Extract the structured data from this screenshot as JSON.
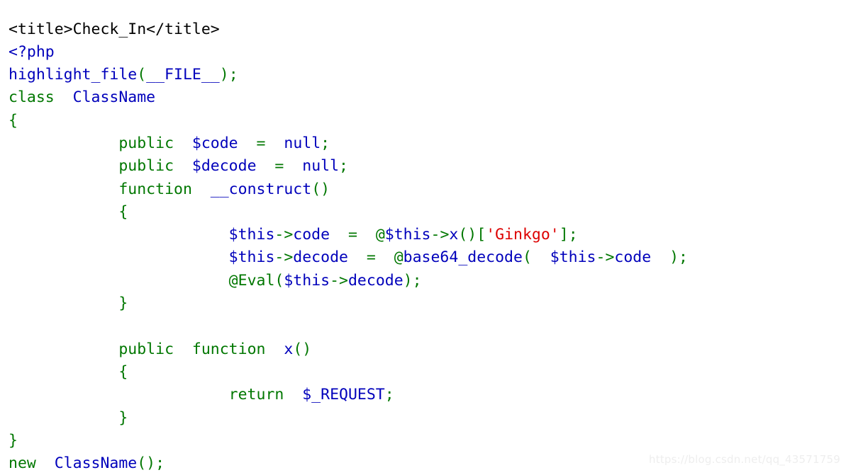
{
  "page": {
    "kind": "php-highlight_file-output",
    "background": "#ffffff",
    "colors": {
      "keyword": "#007700",
      "string": "#DD0000",
      "default": "#0000BB",
      "html": "#000000",
      "watermark": "#eeeeee"
    }
  },
  "watermark": {
    "text": "https://blog.csdn.net/qq_43571759"
  },
  "code": {
    "lines": [
      {
        "n": 1,
        "tokens": [
          {
            "t": "<title>Check_In</title>",
            "c": "html"
          }
        ]
      },
      {
        "n": 2,
        "tokens": [
          {
            "t": "<?php",
            "c": "df"
          }
        ]
      },
      {
        "n": 3,
        "tokens": [
          {
            "t": "highlight_file",
            "c": "df"
          },
          {
            "t": "(",
            "c": "kw"
          },
          {
            "t": "__FILE__",
            "c": "df"
          },
          {
            "t": ")",
            "c": "kw"
          },
          {
            "t": ";",
            "c": "kw"
          }
        ]
      },
      {
        "n": 4,
        "tokens": [
          {
            "t": "class",
            "c": "kw"
          },
          {
            "t": "  ",
            "c": "kw"
          },
          {
            "t": "ClassName",
            "c": "df"
          }
        ]
      },
      {
        "n": 5,
        "tokens": [
          {
            "t": "{",
            "c": "kw"
          }
        ]
      },
      {
        "n": 6,
        "tokens": [
          {
            "t": "            ",
            "c": "kw"
          },
          {
            "t": "public",
            "c": "kw"
          },
          {
            "t": "  ",
            "c": "kw"
          },
          {
            "t": "$code",
            "c": "df"
          },
          {
            "t": "  ",
            "c": "kw"
          },
          {
            "t": "=",
            "c": "kw"
          },
          {
            "t": "  ",
            "c": "kw"
          },
          {
            "t": "null",
            "c": "df"
          },
          {
            "t": ";",
            "c": "kw"
          }
        ]
      },
      {
        "n": 7,
        "tokens": [
          {
            "t": "            ",
            "c": "kw"
          },
          {
            "t": "public",
            "c": "kw"
          },
          {
            "t": "  ",
            "c": "kw"
          },
          {
            "t": "$decode",
            "c": "df"
          },
          {
            "t": "  ",
            "c": "kw"
          },
          {
            "t": "=",
            "c": "kw"
          },
          {
            "t": "  ",
            "c": "kw"
          },
          {
            "t": "null",
            "c": "df"
          },
          {
            "t": ";",
            "c": "kw"
          }
        ]
      },
      {
        "n": 8,
        "tokens": [
          {
            "t": "            ",
            "c": "kw"
          },
          {
            "t": "function",
            "c": "kw"
          },
          {
            "t": "  ",
            "c": "kw"
          },
          {
            "t": "__construct",
            "c": "df"
          },
          {
            "t": "()",
            "c": "kw"
          }
        ]
      },
      {
        "n": 9,
        "tokens": [
          {
            "t": "            ",
            "c": "kw"
          },
          {
            "t": "{",
            "c": "kw"
          }
        ]
      },
      {
        "n": 10,
        "tokens": [
          {
            "t": "                        ",
            "c": "kw"
          },
          {
            "t": "$this",
            "c": "df"
          },
          {
            "t": "->",
            "c": "kw"
          },
          {
            "t": "code",
            "c": "df"
          },
          {
            "t": "  ",
            "c": "kw"
          },
          {
            "t": "=",
            "c": "kw"
          },
          {
            "t": "  ",
            "c": "kw"
          },
          {
            "t": "@",
            "c": "kw"
          },
          {
            "t": "$this",
            "c": "df"
          },
          {
            "t": "->",
            "c": "kw"
          },
          {
            "t": "x",
            "c": "df"
          },
          {
            "t": "()[",
            "c": "kw"
          },
          {
            "t": "'Ginkgo'",
            "c": "st"
          },
          {
            "t": "]",
            "c": "kw"
          },
          {
            "t": ";",
            "c": "kw"
          }
        ]
      },
      {
        "n": 11,
        "tokens": [
          {
            "t": "                        ",
            "c": "kw"
          },
          {
            "t": "$this",
            "c": "df"
          },
          {
            "t": "->",
            "c": "kw"
          },
          {
            "t": "decode",
            "c": "df"
          },
          {
            "t": "  ",
            "c": "kw"
          },
          {
            "t": "=",
            "c": "kw"
          },
          {
            "t": "  ",
            "c": "kw"
          },
          {
            "t": "@",
            "c": "kw"
          },
          {
            "t": "base64_decode",
            "c": "df"
          },
          {
            "t": "(",
            "c": "kw"
          },
          {
            "t": "  ",
            "c": "kw"
          },
          {
            "t": "$this",
            "c": "df"
          },
          {
            "t": "->",
            "c": "kw"
          },
          {
            "t": "code",
            "c": "df"
          },
          {
            "t": "  ",
            "c": "kw"
          },
          {
            "t": ")",
            "c": "kw"
          },
          {
            "t": ";",
            "c": "kw"
          }
        ]
      },
      {
        "n": 12,
        "tokens": [
          {
            "t": "                        ",
            "c": "kw"
          },
          {
            "t": "@",
            "c": "kw"
          },
          {
            "t": "Eval",
            "c": "kw"
          },
          {
            "t": "(",
            "c": "kw"
          },
          {
            "t": "$this",
            "c": "df"
          },
          {
            "t": "->",
            "c": "kw"
          },
          {
            "t": "decode",
            "c": "df"
          },
          {
            "t": ")",
            "c": "kw"
          },
          {
            "t": ";",
            "c": "kw"
          }
        ]
      },
      {
        "n": 13,
        "tokens": [
          {
            "t": "            ",
            "c": "kw"
          },
          {
            "t": "}",
            "c": "kw"
          }
        ]
      },
      {
        "n": 14,
        "tokens": [
          {
            "t": "",
            "c": "kw"
          }
        ]
      },
      {
        "n": 15,
        "tokens": [
          {
            "t": "            ",
            "c": "kw"
          },
          {
            "t": "public",
            "c": "kw"
          },
          {
            "t": "  ",
            "c": "kw"
          },
          {
            "t": "function",
            "c": "kw"
          },
          {
            "t": "  ",
            "c": "kw"
          },
          {
            "t": "x",
            "c": "df"
          },
          {
            "t": "()",
            "c": "kw"
          }
        ]
      },
      {
        "n": 16,
        "tokens": [
          {
            "t": "            ",
            "c": "kw"
          },
          {
            "t": "{",
            "c": "kw"
          }
        ]
      },
      {
        "n": 17,
        "tokens": [
          {
            "t": "                        ",
            "c": "kw"
          },
          {
            "t": "return",
            "c": "kw"
          },
          {
            "t": "  ",
            "c": "kw"
          },
          {
            "t": "$_REQUEST",
            "c": "df"
          },
          {
            "t": ";",
            "c": "kw"
          }
        ]
      },
      {
        "n": 18,
        "tokens": [
          {
            "t": "            ",
            "c": "kw"
          },
          {
            "t": "}",
            "c": "kw"
          }
        ]
      },
      {
        "n": 19,
        "tokens": [
          {
            "t": "}",
            "c": "kw"
          }
        ]
      },
      {
        "n": 20,
        "tokens": [
          {
            "t": "new",
            "c": "kw"
          },
          {
            "t": "  ",
            "c": "kw"
          },
          {
            "t": "ClassName",
            "c": "df"
          },
          {
            "t": "()",
            "c": "kw"
          },
          {
            "t": ";",
            "c": "kw"
          }
        ]
      }
    ]
  }
}
